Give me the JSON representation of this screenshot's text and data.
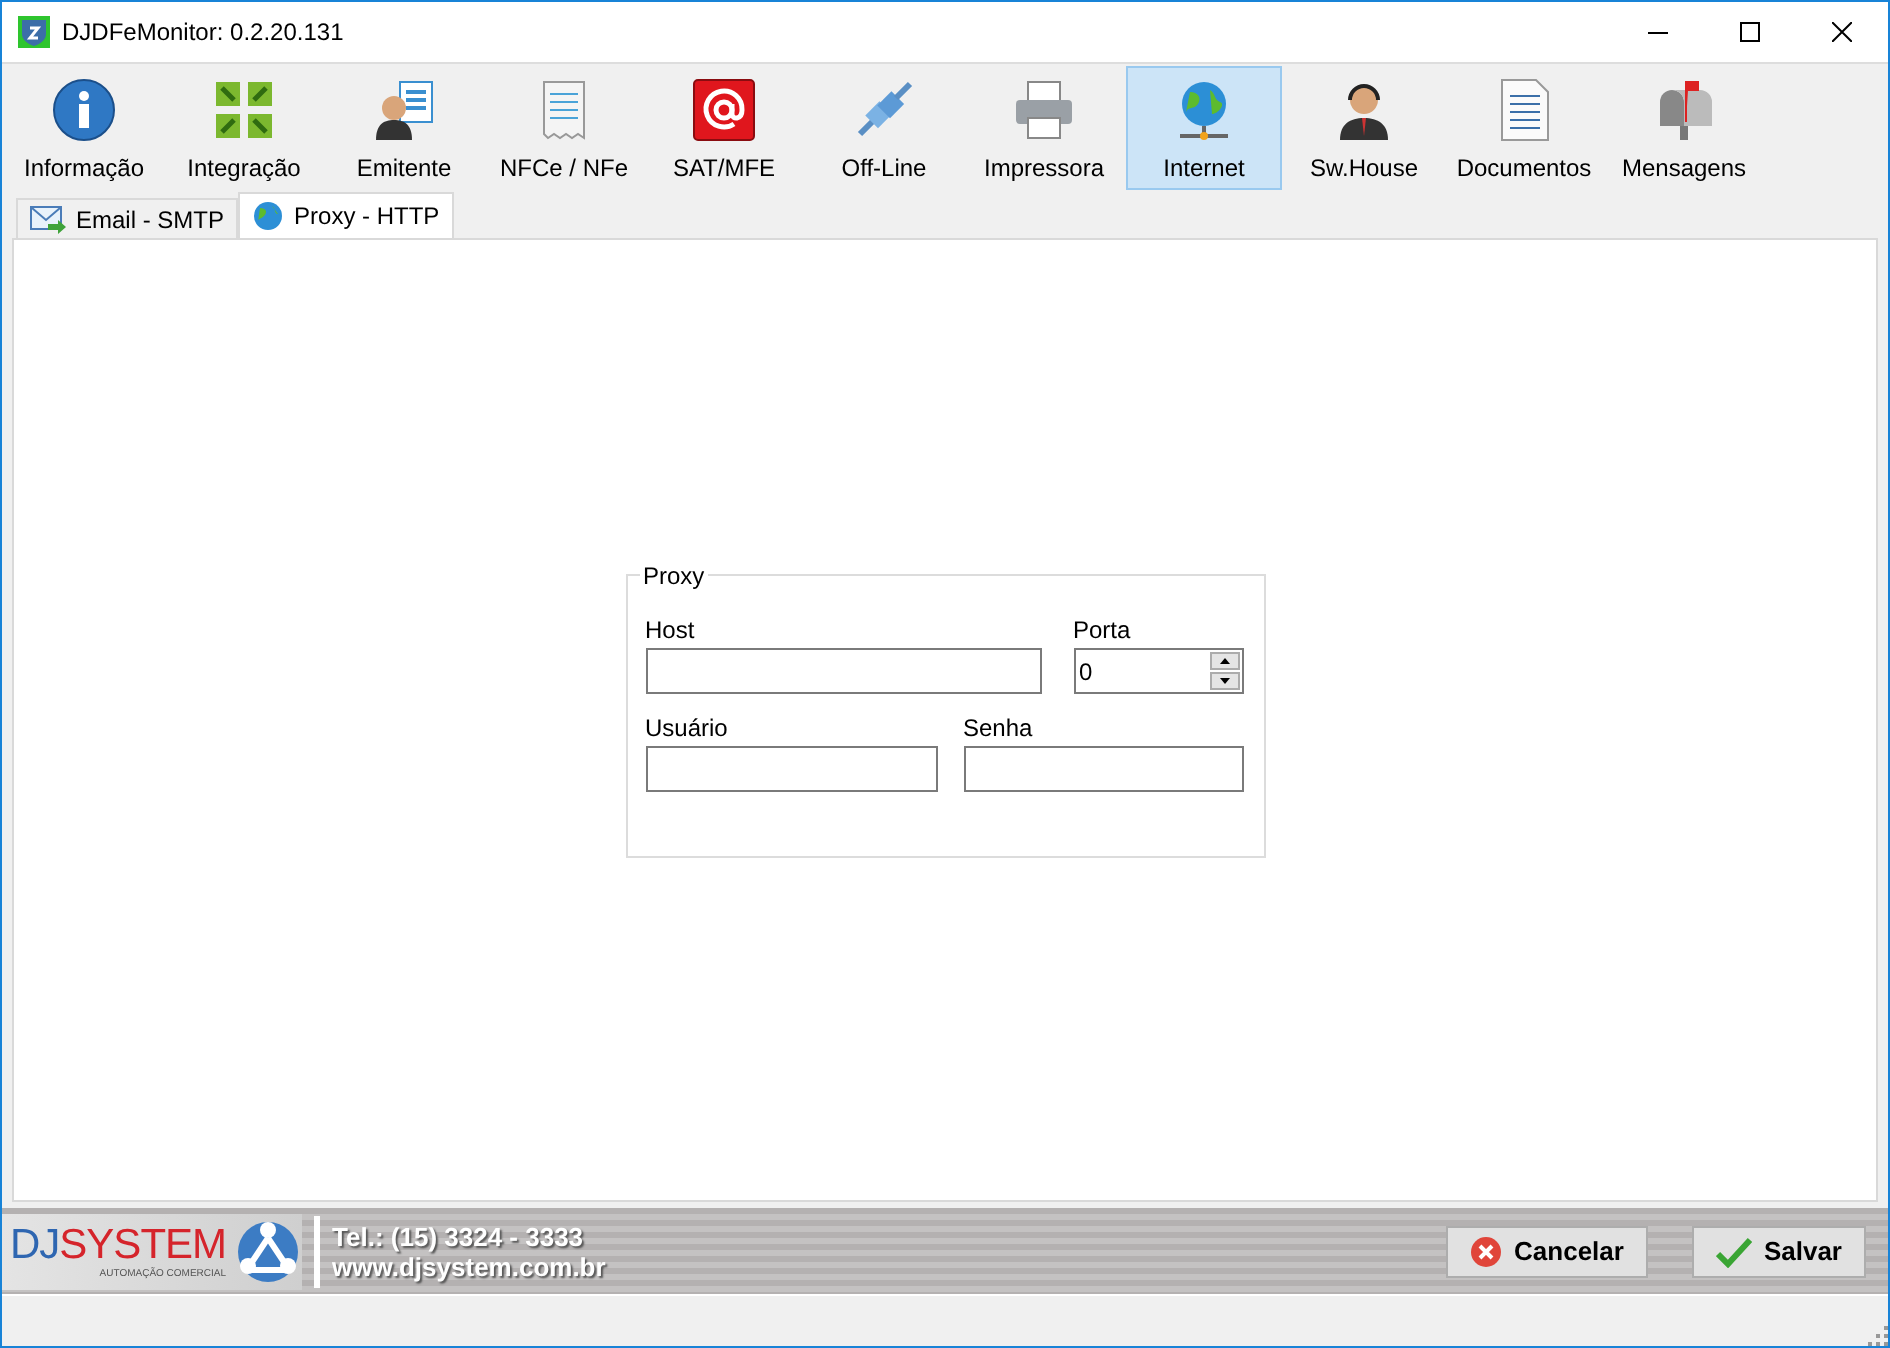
{
  "window": {
    "title": "DJDFeMonitor: 0.2.20.131"
  },
  "toolbar": [
    {
      "label": "Informação",
      "kind": "info",
      "selected": false
    },
    {
      "label": "Integração",
      "kind": "arrows",
      "selected": false
    },
    {
      "label": "Emitente",
      "kind": "person",
      "selected": false
    },
    {
      "label": "NFCe / NFe",
      "kind": "receipt",
      "selected": false
    },
    {
      "label": "SAT/MFE",
      "kind": "at",
      "selected": false
    },
    {
      "label": "Off-Line",
      "kind": "plug",
      "selected": false
    },
    {
      "label": "Impressora",
      "kind": "printer",
      "selected": false
    },
    {
      "label": "Internet",
      "kind": "globe",
      "selected": true
    },
    {
      "label": "Sw.House",
      "kind": "headset",
      "selected": false
    },
    {
      "label": "Documentos",
      "kind": "document",
      "selected": false
    },
    {
      "label": "Mensagens",
      "kind": "mailbox",
      "selected": false
    }
  ],
  "tabs": [
    {
      "label": "Email - SMTP",
      "kind": "mail",
      "selected": false
    },
    {
      "label": "Proxy - HTTP",
      "kind": "globe",
      "selected": true
    }
  ],
  "proxy": {
    "title": "Proxy",
    "host": {
      "label": "Host"
    },
    "port": {
      "label": "Porta",
      "value": "0"
    },
    "user": {
      "label": "Usuário"
    },
    "password": {
      "label": "Senha"
    }
  },
  "footer": {
    "logo": {
      "prefix": "DJ",
      "name": "SYSTEM",
      "tagline": "AUTOMAÇÃO COMERCIAL"
    },
    "phone": "Tel.: (15) 3324 - 3333",
    "website": "www.djsystem.com.br",
    "buttons": [
      {
        "label": "Cancelar",
        "kind": "cancel"
      },
      {
        "label": "Salvar",
        "kind": "save"
      }
    ]
  }
}
